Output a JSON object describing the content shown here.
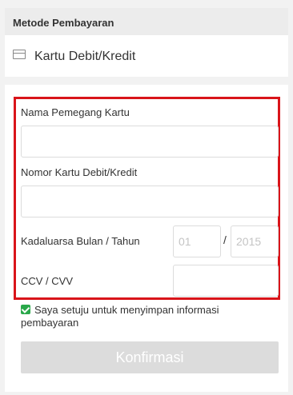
{
  "section": {
    "title": "Metode Pembayaran"
  },
  "payment_method": {
    "icon": "credit-card-icon",
    "label": "Kartu Debit/Kredit"
  },
  "form": {
    "cardholder_label": "Nama Pemegang Kartu",
    "cardholder_value": "",
    "card_number_label": "Nomor Kartu Debit/Kredit",
    "card_number_value": "",
    "expiry_label": "Kadaluarsa Bulan / Tahun",
    "expiry_month_placeholder": "01",
    "expiry_separator": "/",
    "expiry_year_placeholder": "2015",
    "cvv_label": "CCV / CVV",
    "cvv_value": ""
  },
  "consent": {
    "checked": true,
    "text": "Saya setuju untuk menyimpan informasi pembayaran"
  },
  "confirm": {
    "label": "Konfirmasi",
    "enabled": false
  },
  "colors": {
    "highlight": "#d9141a",
    "checkbox": "#2aa84a",
    "button_disabled": "#dcdcdc"
  }
}
